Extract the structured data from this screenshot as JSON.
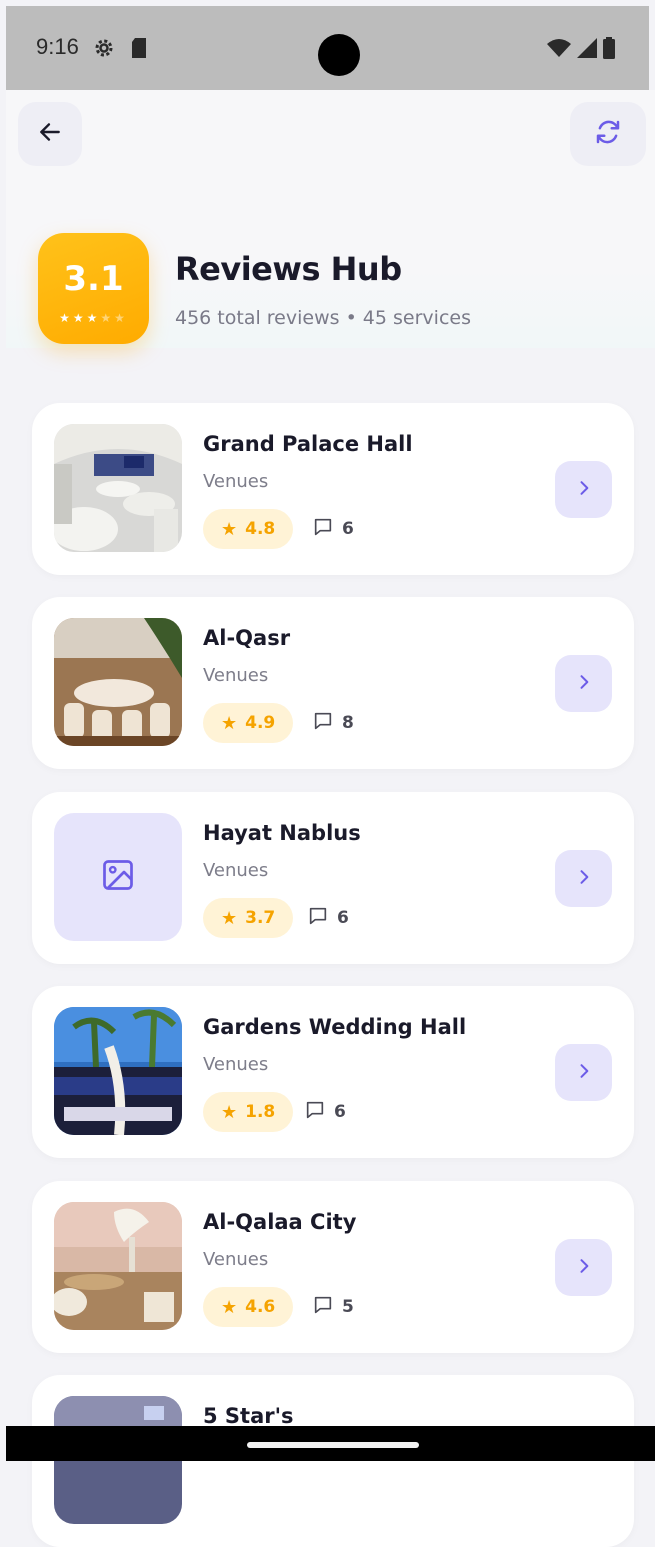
{
  "status_bar": {
    "time": "9:16"
  },
  "header": {
    "overall_rating": "3.1",
    "overall_stars": 3,
    "max_stars": 5,
    "title": "Reviews Hub",
    "subtitle": "456 total reviews • 45 services",
    "icons": {
      "back": "arrow-left-icon",
      "refresh": "refresh-icon"
    }
  },
  "colors": {
    "accent": "#6c5ce7",
    "badge": "#ffb300",
    "rating_text": "#f5a300",
    "rating_bg": "#fff3d6",
    "chevron_bg": "#e6e4fb"
  },
  "services": [
    {
      "name": "Grand Palace Hall",
      "category": "Venues",
      "rating": "4.8",
      "reviews": "6"
    },
    {
      "name": "Al-Qasr",
      "category": "Venues",
      "rating": "4.9",
      "reviews": "8"
    },
    {
      "name": "Hayat Nablus",
      "category": "Venues",
      "rating": "3.7",
      "reviews": "6"
    },
    {
      "name": "Gardens Wedding Hall",
      "category": "Venues",
      "rating": "1.8",
      "reviews": "6"
    },
    {
      "name": "Al-Qalaa City",
      "category": "Venues",
      "rating": "4.6",
      "reviews": "5"
    },
    {
      "name": "5 Star's",
      "category": "",
      "rating": "",
      "reviews": ""
    }
  ]
}
